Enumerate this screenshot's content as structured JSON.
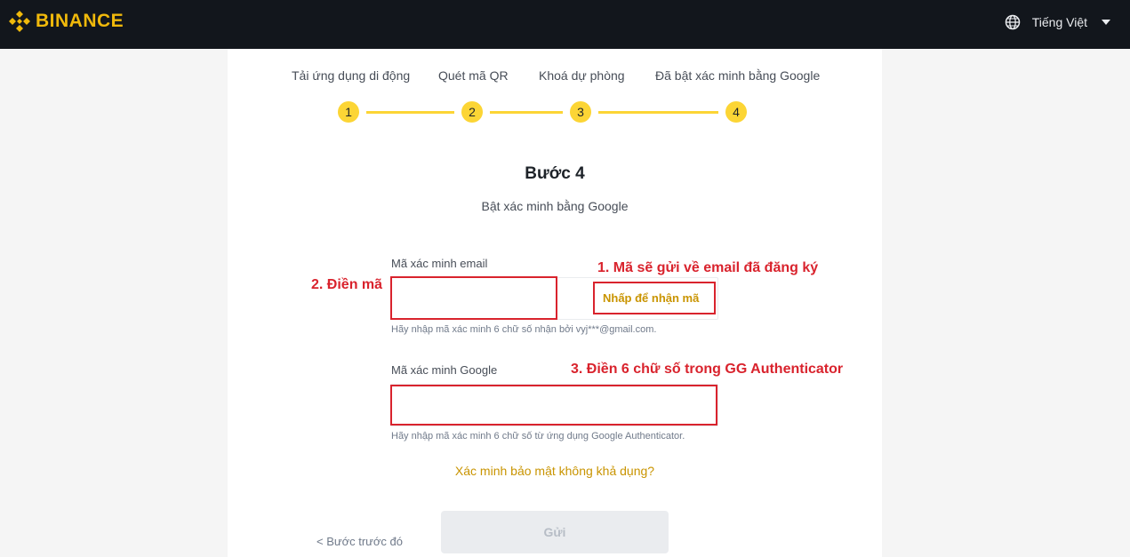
{
  "header": {
    "brand": "BINANCE",
    "brand_color": "#f0b90b",
    "language": "Tiếng Việt",
    "language_icon": "globe-icon"
  },
  "stepper": {
    "steps": [
      {
        "label": "Tải ứng dụng di động",
        "number": "1"
      },
      {
        "label": "Quét mã QR",
        "number": "2"
      },
      {
        "label": "Khoá dự phòng",
        "number": "3"
      },
      {
        "label": "Đã bật xác minh bằng Google",
        "number": "4"
      }
    ],
    "accent": "#fcd535"
  },
  "main": {
    "title": "Bước 4",
    "subtitle": "Bật xác minh bằng Google"
  },
  "email_field": {
    "label": "Mã xác minh email",
    "value": "",
    "get_code": "Nhấp để nhận mã",
    "hint": "Hãy nhập mã xác minh 6 chữ số nhận bởi vyj***@gmail.com."
  },
  "google_field": {
    "label": "Mã xác minh Google",
    "value": "",
    "hint": "Hãy nhập mã xác minh 6 chữ số từ ứng dụng Google Authenticator."
  },
  "security_link": "Xác minh bảo mật không khả dụng?",
  "back_label": "< Bước trước đó",
  "submit_label": "Gửi",
  "annotations": {
    "one": "1. Mã sẽ gửi về email đã đăng ký",
    "two": "2. Điền mã",
    "three": "3. Điền 6 chữ số trong GG Authenticator",
    "color": "#d9232d"
  }
}
